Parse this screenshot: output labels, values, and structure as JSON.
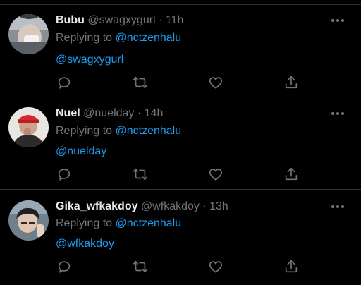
{
  "tweets": [
    {
      "name": "Bubu",
      "handle": "@swagxygurl",
      "separator": "·",
      "time": "11h",
      "replying_prefix": "Replying to",
      "replying_to": "@nctzenhalu",
      "text": "@swagxygurl"
    },
    {
      "name": "Nuel",
      "handle": "@nuelday",
      "separator": "·",
      "time": "14h",
      "replying_prefix": "Replying to",
      "replying_to": "@nctzenhalu",
      "text": "@nuelday"
    },
    {
      "name": "Gika_wfkakdoy",
      "handle": "@wfkakdoy",
      "separator": "·",
      "time": "13h",
      "replying_prefix": "Replying to",
      "replying_to": "@nctzenhalu",
      "text": "@wfkakdoy"
    }
  ],
  "icons": {
    "more": "more-icon",
    "reply": "reply-icon",
    "retweet": "retweet-icon",
    "like": "like-icon",
    "share": "share-icon"
  },
  "colors": {
    "background": "#000000",
    "name": "#e7e9ea",
    "muted": "#71767b",
    "accent": "#1d9bf0",
    "divider": "#2f3336"
  }
}
